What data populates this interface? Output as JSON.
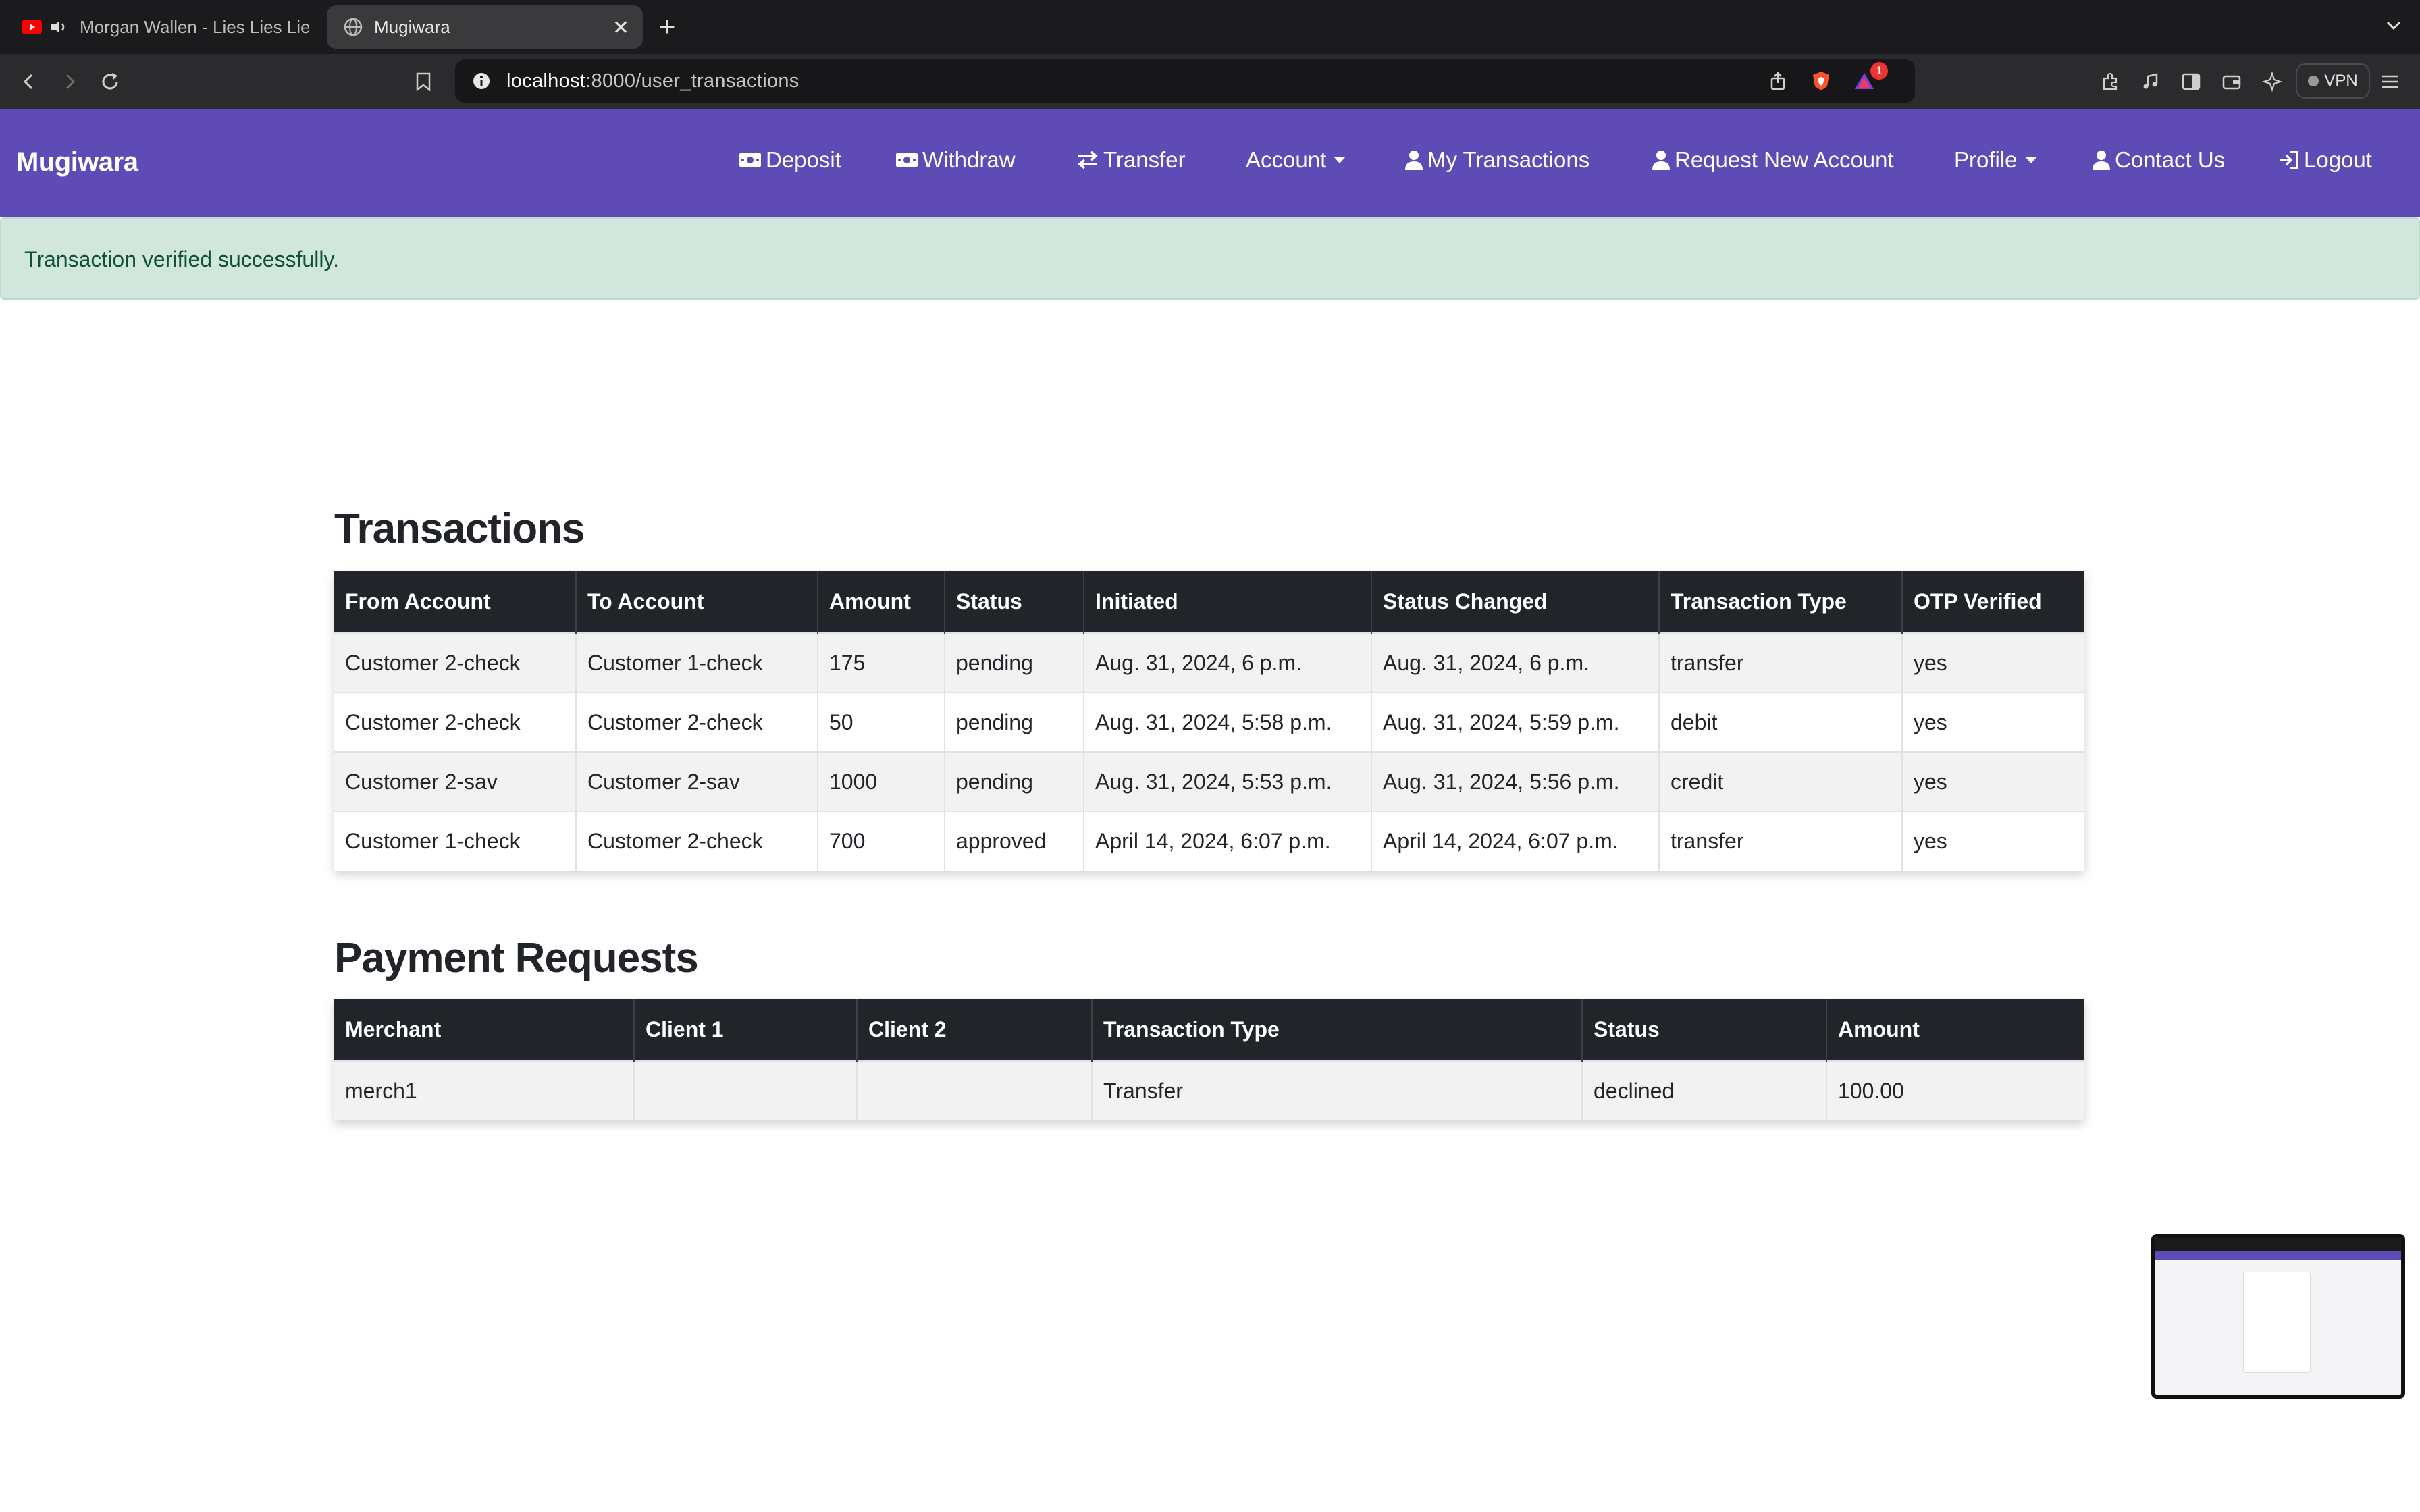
{
  "browser": {
    "tabs": [
      {
        "title": "Morgan Wallen - Lies Lies Lies",
        "icon": "youtube-icon",
        "active": false
      },
      {
        "title": "Mugiwara",
        "icon": "globe-icon",
        "active": true
      }
    ],
    "url_host": "localhost",
    "url_rest": ":8000/user_transactions",
    "vpn_label": "VPN",
    "notification_count": "1"
  },
  "navbar": {
    "brand": "Mugiwara",
    "items": [
      {
        "label": "Deposit",
        "icon": "money-icon"
      },
      {
        "label": "Withdraw",
        "icon": "money-icon"
      },
      {
        "label": "Transfer",
        "icon": "arrows-exchange-icon"
      },
      {
        "label": "Account",
        "dropdown": true
      },
      {
        "label": "My Transactions",
        "icon": "user-icon"
      },
      {
        "label": "Request New Account",
        "icon": "user-icon"
      },
      {
        "label": "Profile",
        "dropdown": true
      },
      {
        "label": "Contact Us",
        "icon": "user-icon"
      },
      {
        "label": "Logout",
        "icon": "sign-out-icon"
      }
    ],
    "color": "#5f4bb6"
  },
  "alert": {
    "message": "Transaction verified successfully.",
    "color": "#d1e7dd"
  },
  "transactions": {
    "title": "Transactions",
    "headers": [
      "From Account",
      "To Account",
      "Amount",
      "Status",
      "Initiated",
      "Status Changed",
      "Transaction Type",
      "OTP Verified"
    ],
    "rows": [
      [
        "Customer 2-check",
        "Customer 1-check",
        "175",
        "pending",
        "Aug. 31, 2024, 6 p.m.",
        "Aug. 31, 2024, 6 p.m.",
        "transfer",
        "yes"
      ],
      [
        "Customer 2-check",
        "Customer 2-check",
        "50",
        "pending",
        "Aug. 31, 2024, 5:58 p.m.",
        "Aug. 31, 2024, 5:59 p.m.",
        "debit",
        "yes"
      ],
      [
        "Customer 2-sav",
        "Customer 2-sav",
        "1000",
        "pending",
        "Aug. 31, 2024, 5:53 p.m.",
        "Aug. 31, 2024, 5:56 p.m.",
        "credit",
        "yes"
      ],
      [
        "Customer 1-check",
        "Customer 2-check",
        "700",
        "approved",
        "April 14, 2024, 6:07 p.m.",
        "April 14, 2024, 6:07 p.m.",
        "transfer",
        "yes"
      ]
    ]
  },
  "payment_requests": {
    "title": "Payment Requests",
    "headers": [
      "Merchant",
      "Client 1",
      "Client 2",
      "Transaction Type",
      "Status",
      "Amount"
    ],
    "rows": [
      [
        "merch1",
        "",
        "",
        "Transfer",
        "declined",
        "100.00"
      ]
    ]
  }
}
